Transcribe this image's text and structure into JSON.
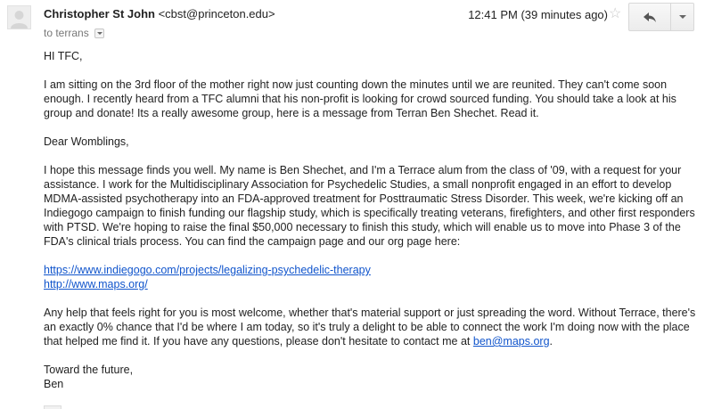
{
  "header": {
    "avatar_icon": "default-person-avatar-icon",
    "sender_name": "Christopher St John",
    "sender_email": "<cbst@princeton.edu>",
    "recipients": "to terrans",
    "timestamp": "12:41 PM (39 minutes ago)",
    "star_icon": "star-outline-icon",
    "reply_icon": "reply-arrow-icon",
    "more_icon": "chevron-down-icon"
  },
  "body": {
    "greeting": "HI TFC,",
    "intro": "I am sitting on the 3rd floor of the mother right now just counting down the minutes until we are reunited. They can't come soon enough. I recently heard from a TFC alumni that his non-profit is looking for crowd sourced funding. You should take a look at his group and donate! Its a really awesome group, here is a message from Terran Ben Shechet. Read it.",
    "salutation": "Dear Womblings,",
    "paragraph1": "I hope this message finds you well. My name is Ben Shechet, and I'm a Terrace alum from the class of '09, with a request for your assistance. I work for the Multidisciplinary Association for Psychedelic Studies, a small nonprofit engaged in an effort to develop MDMA-assisted psychotherapy into an FDA-approved treatment for Posttraumatic Stress Disorder. This week, we're kicking off an Indiegogo campaign to finish funding our flagship study, which is specifically treating veterans, firefighters, and other first responders with PTSD. We're hoping to raise the final $50,000 necessary to finish this study, which will enable us to move into Phase 3 of the FDA's clinical trials process. You can find the campaign page and our org page here:",
    "link1": "https://www.indiegogo.com/projects/legalizing-psychedelic-therapy",
    "link2": "http://www.maps.org/",
    "paragraph2": "Any help that feels right for you is most welcome, whether that's material support or just spreading the word. Without Terrace, there's an exactly 0% chance that I'd be where I am today, so it's truly a delight to be able to connect the work I'm doing now with the place that helped me find it. If you have any questions, please don't hesitate to contact me at",
    "email_link": "ben@maps.org",
    "email_suffix": ".",
    "closing_line1": "Toward the future,",
    "closing_line2": "Ben"
  },
  "colors": {
    "link": "#1155cc",
    "text": "#222222",
    "muted": "#777777"
  }
}
